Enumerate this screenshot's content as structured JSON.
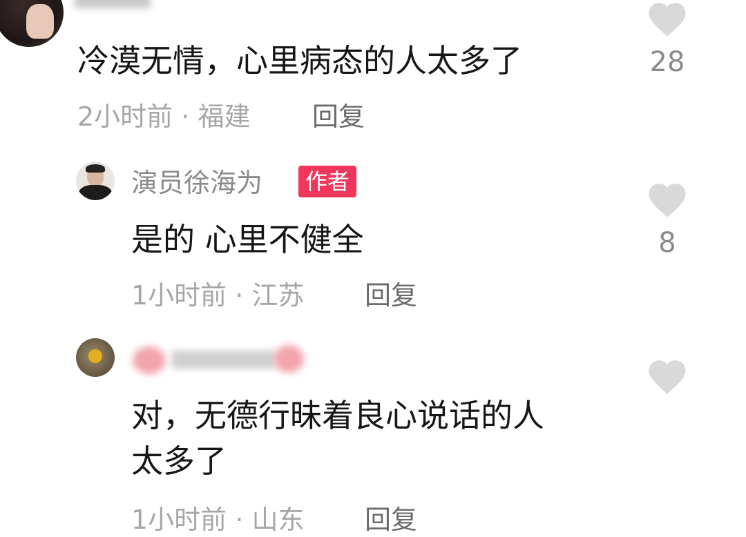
{
  "comments": [
    {
      "text": "冷漠无情，心里病态的人太多了",
      "time": "2小时前",
      "location": "福建",
      "reply_label": "回复",
      "likes": "28"
    },
    {
      "username": "演员徐海为",
      "badge": "作者",
      "text": "是的 心里不健全",
      "time": "1小时前",
      "location": "江苏",
      "reply_label": "回复",
      "likes": "8"
    },
    {
      "text_line1": "对，无德行昧着良心说话的人",
      "text_line2": "太多了",
      "time": "1小时前",
      "location": "山东",
      "reply_label": "回复",
      "likes": ""
    }
  ],
  "separator": " · ",
  "colors": {
    "badge": "#f0365a",
    "heart": "#d9d9d9",
    "text": "#161616",
    "meta": "#a6a6a6"
  },
  "icons": [
    "heart-icon",
    "avatar"
  ]
}
